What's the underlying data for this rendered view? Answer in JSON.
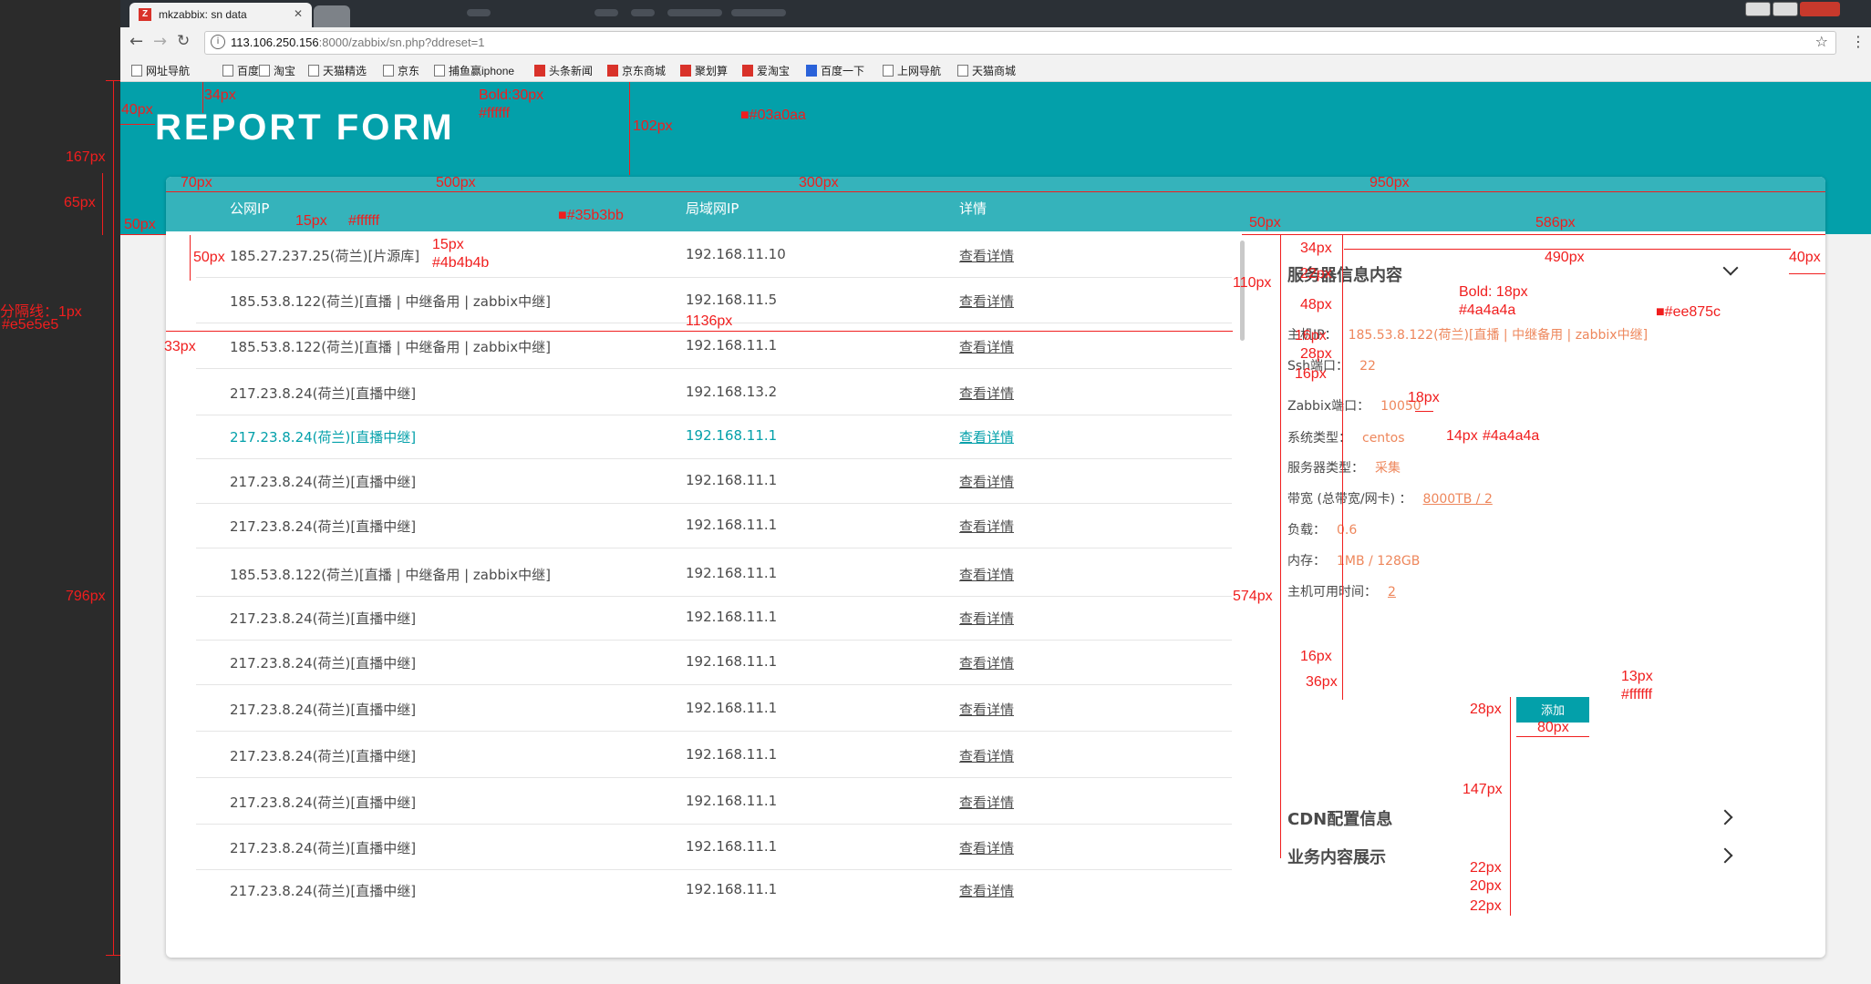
{
  "browser": {
    "tab_title": "mkzabbix: sn data",
    "url_host": "113.106.250.156",
    "url_rest": ":8000/zabbix/sn.php?ddreset=1",
    "bookmarks": [
      "网址导航",
      "百度",
      "淘宝",
      "天猫精选",
      "京东",
      "捕鱼赢iphone",
      "头条新闻",
      "京东商城",
      "聚划算",
      "爱淘宝",
      "百度一下",
      "上网导航",
      "天猫商城"
    ]
  },
  "header": {
    "title": "REPORT FORM"
  },
  "table": {
    "columns": [
      "公网IP",
      "局域网IP",
      "详情"
    ],
    "rows": [
      {
        "public_ip": "185.27.237.25(荷兰)[片源库]",
        "lan_ip": "192.168.11.10",
        "detail": "查看详情"
      },
      {
        "public_ip": "185.53.8.122(荷兰)[直播 | 中继备用 | zabbix中继]",
        "lan_ip": "192.168.11.5",
        "detail": "查看详情"
      },
      {
        "public_ip": "185.53.8.122(荷兰)[直播 | 中继备用 | zabbix中继]",
        "lan_ip": "192.168.11.1",
        "detail": "查看详情"
      },
      {
        "public_ip": "217.23.8.24(荷兰)[直播中继]",
        "lan_ip": "192.168.13.2",
        "detail": "查看详情"
      },
      {
        "public_ip": "217.23.8.24(荷兰)[直播中继]",
        "lan_ip": "192.168.11.1",
        "detail": "查看详情"
      },
      {
        "public_ip": "217.23.8.24(荷兰)[直播中继]",
        "lan_ip": "192.168.11.1",
        "detail": "查看详情"
      },
      {
        "public_ip": "217.23.8.24(荷兰)[直播中继]",
        "lan_ip": "192.168.11.1",
        "detail": "查看详情"
      },
      {
        "public_ip": "185.53.8.122(荷兰)[直播 | 中继备用 | zabbix中继]",
        "lan_ip": "192.168.11.1",
        "detail": "查看详情"
      },
      {
        "public_ip": "217.23.8.24(荷兰)[直播中继]",
        "lan_ip": "192.168.11.1",
        "detail": "查看详情"
      },
      {
        "public_ip": "217.23.8.24(荷兰)[直播中继]",
        "lan_ip": "192.168.11.1",
        "detail": "查看详情"
      },
      {
        "public_ip": "217.23.8.24(荷兰)[直播中继]",
        "lan_ip": "192.168.11.1",
        "detail": "查看详情"
      },
      {
        "public_ip": "217.23.8.24(荷兰)[直播中继]",
        "lan_ip": "192.168.11.1",
        "detail": "查看详情"
      },
      {
        "public_ip": "217.23.8.24(荷兰)[直播中继]",
        "lan_ip": "192.168.11.1",
        "detail": "查看详情"
      },
      {
        "public_ip": "217.23.8.24(荷兰)[直播中继]",
        "lan_ip": "192.168.11.1",
        "detail": "查看详情"
      },
      {
        "public_ip": "217.23.8.24(荷兰)[直播中继]",
        "lan_ip": "192.168.11.1",
        "detail": "查看详情"
      }
    ],
    "active_row": 4
  },
  "server_info": {
    "title": "服务器信息内容",
    "fields": [
      {
        "label": "主机IP：",
        "value": "185.53.8.122(荷兰)[直播 | 中继备用 | zabbix中继]"
      },
      {
        "label": "Ssh端口：",
        "value": "22"
      },
      {
        "label": "Zabbix端口：",
        "value": "10050"
      },
      {
        "label": "系统类型：",
        "value": "centos"
      },
      {
        "label": "服务器类型：",
        "value": "采集"
      },
      {
        "label": "带宽 (总带宽/网卡) ：",
        "value": "8000TB / 2"
      },
      {
        "label": "负载：",
        "value": "0.6"
      },
      {
        "label": "内存：",
        "value": "1MB / 128GB"
      },
      {
        "label": "主机可用时间：",
        "value": "2"
      }
    ],
    "add_button": "添加",
    "cdn_title": "CDN配置信息",
    "business_title": "业务内容展示"
  },
  "annotations": {
    "a40": "40px",
    "a34": "34px",
    "bold30": "Bold:30px",
    "white1": "#ffffff",
    "a102": "102px",
    "teal": "■#03a0aa",
    "a167": "167px",
    "a65": "65px",
    "a70": "70px",
    "a500": "500px",
    "a300": "300px",
    "a950": "950px",
    "a15": "15px",
    "white2": "#ffffff",
    "headbg": "■#35b3bb",
    "a50a": "50px",
    "a50b": "50px",
    "a586": "586px",
    "a50c": "50px",
    "a15b": "15px",
    "gray1": "#4b4b4b",
    "divider": "分隔线：1px",
    "divcolor": "#e5e5e5",
    "a33": "33px",
    "a1136": "1136px",
    "a110": "110px",
    "a34b": "34px",
    "a490": "490px",
    "a40b": "40px",
    "a22a": "22px",
    "bold18": "Bold: 18px",
    "gray2": "#4a4a4a",
    "a48": "48px",
    "orange": "■#ee875c",
    "a16a": "16px",
    "a28a": "28px",
    "a16b": "16px",
    "a18": "18px",
    "a14": "14px",
    "gray3": "#4a4a4a",
    "a574": "574px",
    "a796": "796px",
    "a16c": "16px",
    "a36": "36px",
    "a13": "13px",
    "white3": "#ffffff",
    "a28b": "28px",
    "a80": "80px",
    "a147": "147px",
    "a22b": "22px",
    "a20": "20px",
    "a22c": "22px"
  }
}
